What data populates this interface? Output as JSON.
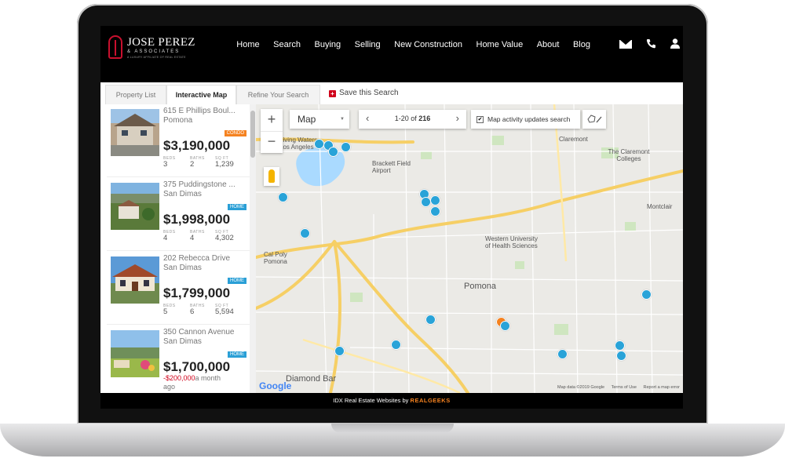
{
  "brand": {
    "name": "JOSE PEREZ",
    "sub": "& ASSOCIATES",
    "tagline": "A LUXURY AFFILIATE OF REAL ESTATE"
  },
  "nav": {
    "items": [
      "Home",
      "Search",
      "Buying",
      "Selling",
      "New Construction",
      "Home Value",
      "About",
      "Blog"
    ]
  },
  "tabs": {
    "items": [
      "Property List",
      "Interactive Map",
      "Refine Your Search"
    ],
    "active": "Interactive Map",
    "save_label": "Save this Search"
  },
  "listings": [
    {
      "address": "615 E Phillips Boul...",
      "city": "Pomona",
      "badge": "CONDO",
      "badge_color": "#f58220",
      "price": "$3,190,000",
      "beds": "3",
      "baths": "2",
      "sqft": "1,239"
    },
    {
      "address": "375 Puddingstone ...",
      "city": "San Dimas",
      "badge": "HOME",
      "badge_color": "#2a9fd6",
      "price": "$1,998,000",
      "beds": "4",
      "baths": "4",
      "sqft": "4,302"
    },
    {
      "address": "202 Rebecca Drive",
      "city": "San Dimas",
      "badge": "HOME",
      "badge_color": "#2a9fd6",
      "price": "$1,799,000",
      "beds": "5",
      "baths": "6",
      "sqft": "5,594"
    },
    {
      "address": "350 Cannon Avenue",
      "city": "San Dimas",
      "badge": "HOME",
      "badge_color": "#2a9fd6",
      "price": "$1,700,000",
      "reduction": "-$200,000",
      "reduction_suffix": "a month",
      "reduction_ago": "ago"
    }
  ],
  "stat_labels": {
    "beds": "BEDS",
    "baths": "BATHS",
    "sqft": "SQ FT"
  },
  "map": {
    "type_label": "Map",
    "pager_range": "1-20",
    "pager_of": "of",
    "pager_total": "216",
    "activity_label": "Map activity updates search",
    "activity_checked": true,
    "places": {
      "pomona": "Pomona",
      "diamond_bar": "Diamond Bar",
      "claremont": "Claremont",
      "claremont_colleges": "The Claremont Colleges",
      "montclair": "Montclair",
      "western": "Western University of Health Sciences",
      "cal_poly": "Cal Poly Pomona",
      "brackett": "Brackett Field Airport",
      "living_waters": "Living Waters Los Angeles",
      "cal_poly_short": "Cal Poly"
    },
    "credit": [
      "Map data ©2019 Google",
      "Terms of Use",
      "Report a map error"
    ],
    "google": "Google"
  },
  "footer": {
    "text": "IDX Real Estate Websites by",
    "brand": "REALGEEKS"
  },
  "colors": {
    "accent": "#29a3d8",
    "brand_red": "#c8102e",
    "reduction": "#d0021b"
  }
}
